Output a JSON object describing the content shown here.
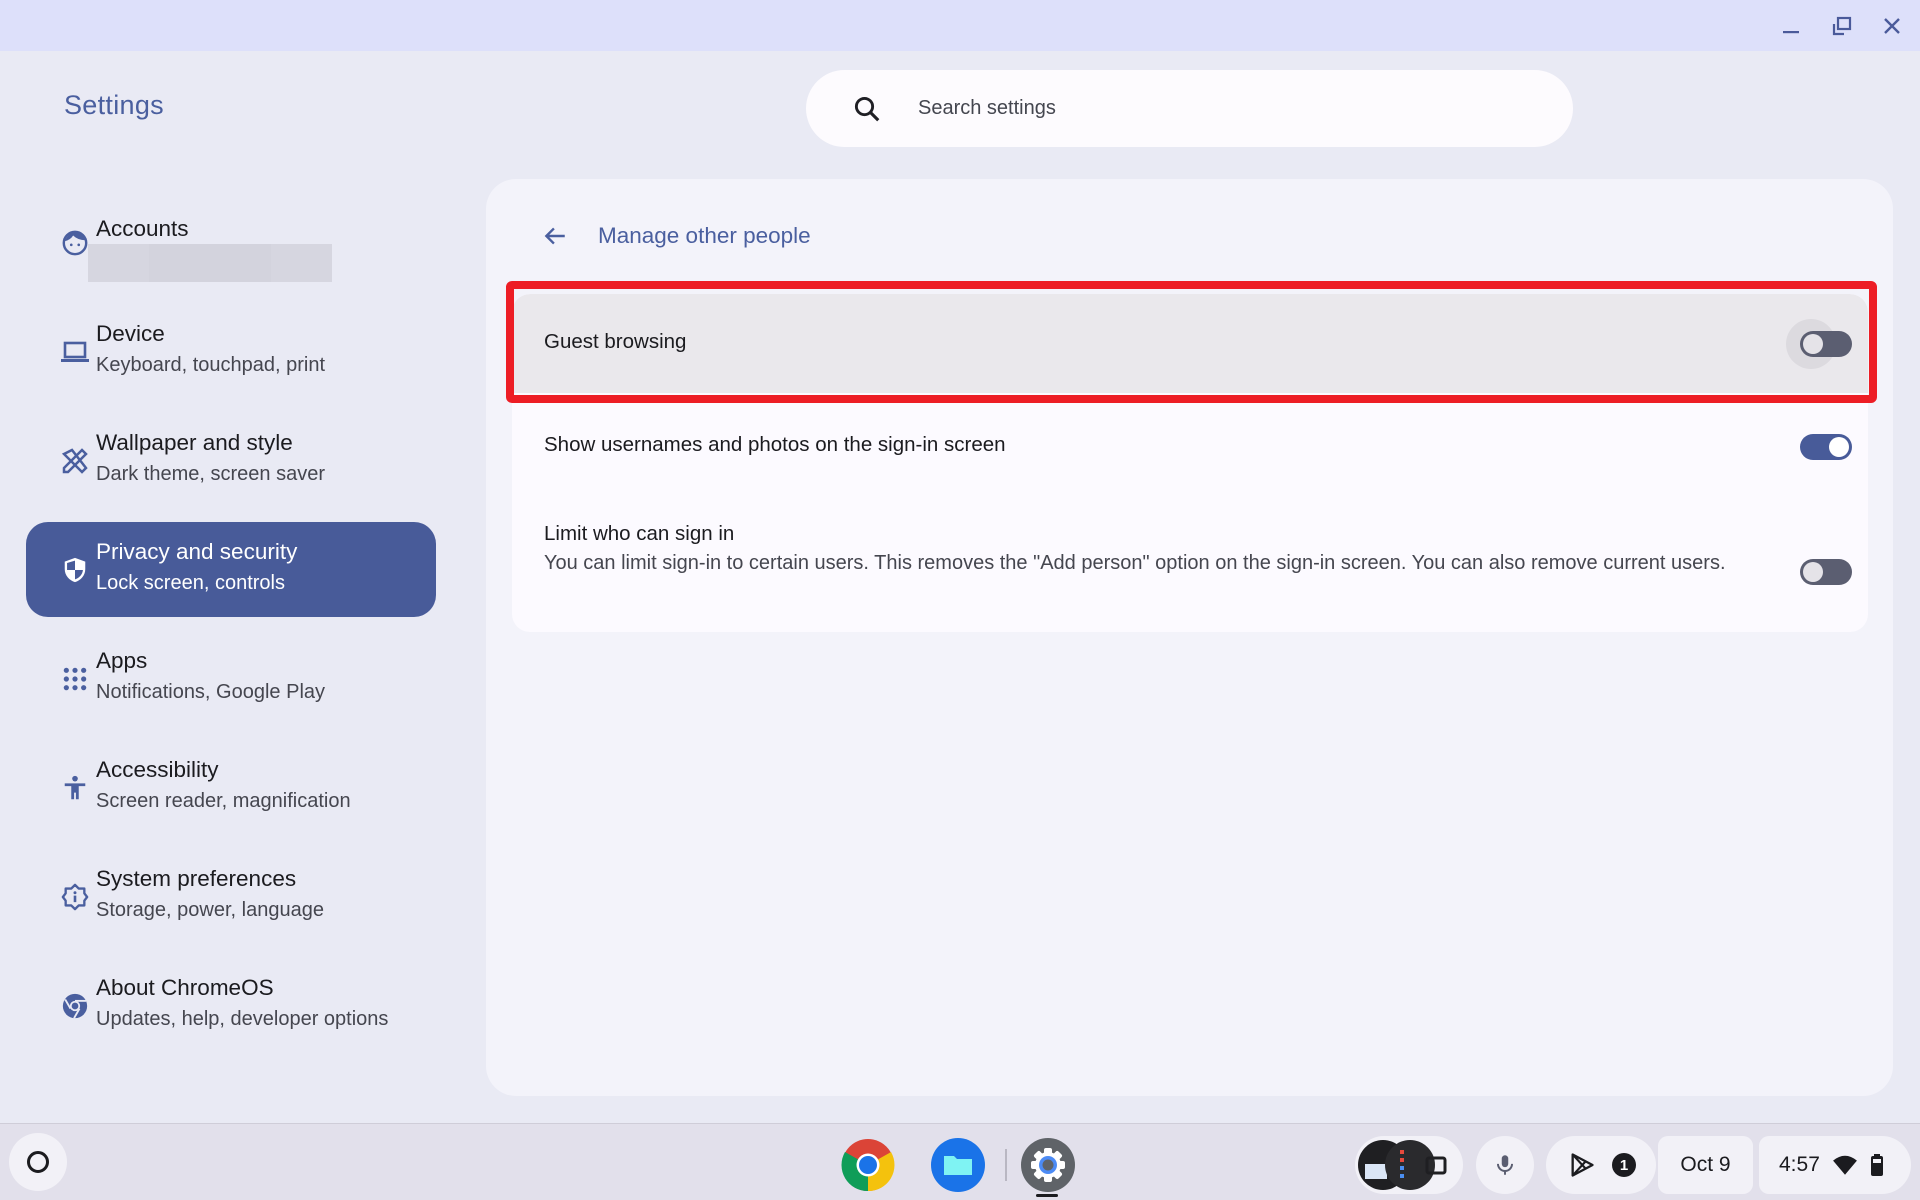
{
  "window": {
    "controls": {
      "minimize": "minimize-icon",
      "restore": "restore-icon",
      "close": "close-icon"
    }
  },
  "app": {
    "title": "Settings"
  },
  "search": {
    "placeholder": "Search settings",
    "value": ""
  },
  "sidebar": {
    "items": [
      {
        "label": "Accounts",
        "sublabel": "",
        "icon": "account-face-icon",
        "active": false
      },
      {
        "label": "Device",
        "sublabel": "Keyboard, touchpad, print",
        "icon": "laptop-icon",
        "active": false
      },
      {
        "label": "Wallpaper and style",
        "sublabel": "Dark theme, screen saver",
        "icon": "paintbrush-ruler-icon",
        "active": false
      },
      {
        "label": "Privacy and security",
        "sublabel": "Lock screen, controls",
        "icon": "shield-icon",
        "active": true
      },
      {
        "label": "Apps",
        "sublabel": "Notifications, Google Play",
        "icon": "apps-grid-icon",
        "active": false
      },
      {
        "label": "Accessibility",
        "sublabel": "Screen reader, magnification",
        "icon": "accessibility-icon",
        "active": false
      },
      {
        "label": "System preferences",
        "sublabel": "Storage, power, language",
        "icon": "system-gear-icon",
        "active": false
      },
      {
        "label": "About ChromeOS",
        "sublabel": "Updates, help, developer options",
        "icon": "chromeos-icon",
        "active": false
      }
    ]
  },
  "page": {
    "title": "Manage other people",
    "settings": [
      {
        "label": "Guest browsing",
        "description": "",
        "enabled": false,
        "highlighted": true
      },
      {
        "label": "Show usernames and photos on the sign-in screen",
        "description": "",
        "enabled": true,
        "highlighted": false
      },
      {
        "label": "Limit who can sign in",
        "description": "You can limit sign-in to certain users. This removes the \"Add person\" option on the sign-in screen. You can also remove current users.",
        "enabled": false,
        "highlighted": false
      }
    ]
  },
  "shelf": {
    "apps": [
      {
        "name": "Chrome",
        "icon": "chrome-icon"
      },
      {
        "name": "Files",
        "icon": "files-icon"
      },
      {
        "name": "Settings",
        "icon": "settings-app-icon",
        "active": true
      }
    ],
    "notification_count": "1",
    "date": "Oct 9",
    "time": "4:57",
    "colors": {
      "accent": "#485b99",
      "highlight": "#ed1d25"
    }
  }
}
